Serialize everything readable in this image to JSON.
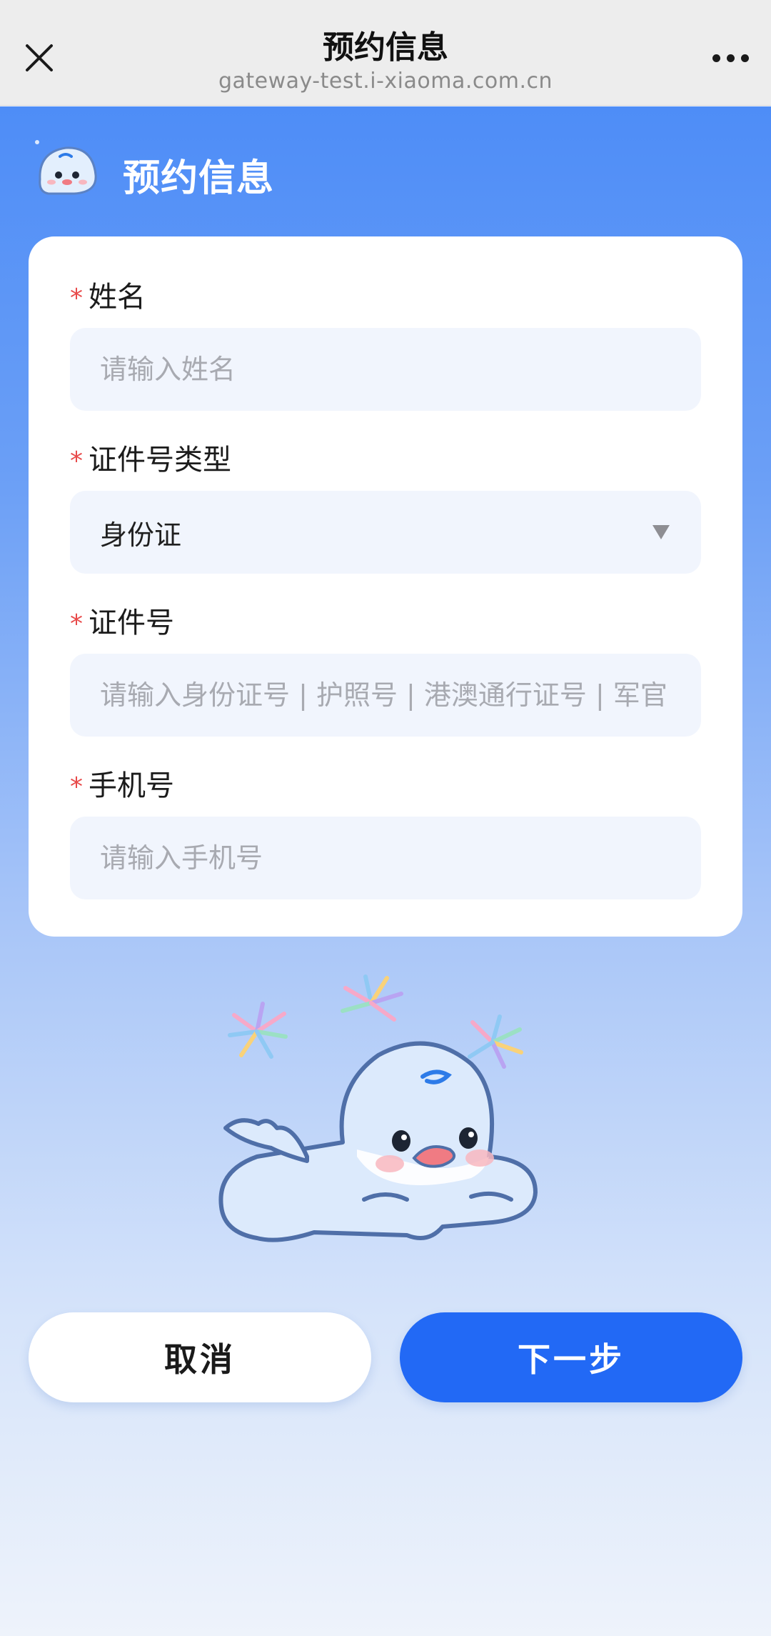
{
  "browser": {
    "title": "预约信息",
    "url": "gateway-test.i-xiaoma.com.cn",
    "close_icon": "close-icon",
    "more_icon": "more-icon"
  },
  "header": {
    "heading": "预约信息",
    "mascot_icon": "whale-mascot-icon"
  },
  "form": {
    "name": {
      "label": "姓名",
      "required_mark": "*",
      "placeholder": "请输入姓名"
    },
    "id_type": {
      "label": "证件号类型",
      "required_mark": "*",
      "value": "身份证",
      "caret_icon": "dropdown-caret-icon"
    },
    "id_number": {
      "label": "证件号",
      "required_mark": "*",
      "placeholder": "请输入身份证号 | 护照号 | 港澳通行证号 | 军官"
    },
    "phone": {
      "label": "手机号",
      "required_mark": "*",
      "placeholder": "请输入手机号"
    }
  },
  "actions": {
    "cancel_label": "取消",
    "next_label": "下一步"
  },
  "colors": {
    "accent": "#2269f5",
    "required": "#e84a4a",
    "background_top": "#4e8df7",
    "input_bg": "#f1f5fd"
  }
}
